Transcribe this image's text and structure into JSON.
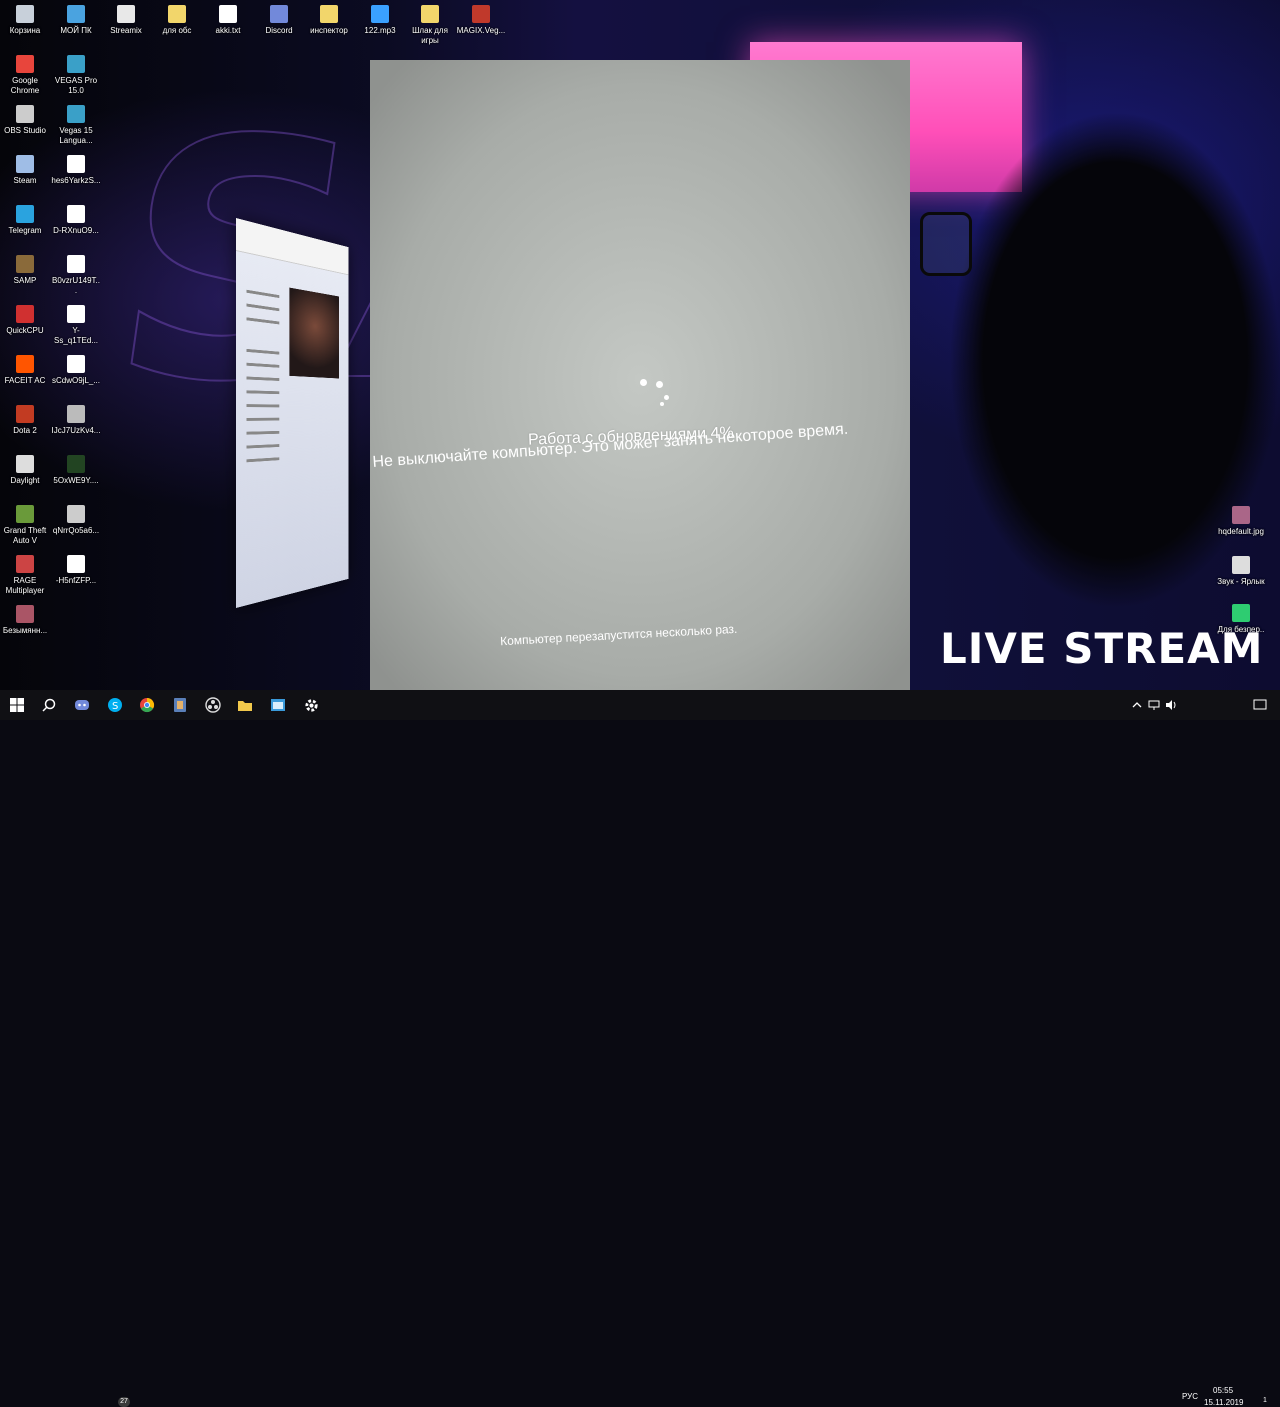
{
  "desktop_icons_left": [
    {
      "id": "recycle",
      "label": "Корзина",
      "icon": "recycle-bin-icon",
      "color": "#c8d0da"
    },
    {
      "id": "mypc",
      "label": "МОЙ ПК",
      "icon": "computer-icon",
      "color": "#4aa3e0"
    },
    {
      "id": "streamix",
      "label": "Streamix",
      "icon": "document-icon",
      "color": "#e8e8e8"
    },
    {
      "id": "obs-folder",
      "label": "для обс",
      "icon": "folder-icon",
      "color": "#f2d66b"
    },
    {
      "id": "akki",
      "label": "akki.txt",
      "icon": "text-file-icon",
      "color": "#ffffff"
    },
    {
      "id": "discord",
      "label": "Discord",
      "icon": "discord-icon",
      "color": "#7289da"
    },
    {
      "id": "inspector",
      "label": "инспектор",
      "icon": "folder-icon",
      "color": "#f2d66b"
    },
    {
      "id": "mp3",
      "label": "122.mp3",
      "icon": "audio-file-icon",
      "color": "#3aa0ff"
    },
    {
      "id": "shlak",
      "label": "Шлак для игры",
      "icon": "folder-icon",
      "color": "#f2d66b"
    },
    {
      "id": "magix",
      "label": "MAGIX.Veg...",
      "icon": "archive-icon",
      "color": "#c0392b"
    }
  ],
  "desktop_icons_col1": [
    {
      "id": "chrome",
      "label": "Google Chrome",
      "icon": "chrome-icon",
      "color": "#e8453c"
    },
    {
      "id": "obs",
      "label": "OBS Studio",
      "icon": "obs-icon",
      "color": "#cccccc"
    },
    {
      "id": "steam",
      "label": "Steam",
      "icon": "steam-icon",
      "color": "#9fbde6"
    },
    {
      "id": "telegram",
      "label": "Telegram",
      "icon": "telegram-icon",
      "color": "#2aa3df"
    },
    {
      "id": "samp",
      "label": "SAMP",
      "icon": "samp-icon",
      "color": "#8a6a3a"
    },
    {
      "id": "quickcpu",
      "label": "QuickCPU",
      "icon": "quickcpu-icon",
      "color": "#d03030"
    },
    {
      "id": "faceit",
      "label": "FACEIT AC",
      "icon": "faceit-icon",
      "color": "#ff5500"
    },
    {
      "id": "dota",
      "label": "Dota 2",
      "icon": "dota-icon",
      "color": "#c23b22"
    },
    {
      "id": "daylight",
      "label": "Daylight",
      "icon": "daylight-icon",
      "color": "#dddddd"
    },
    {
      "id": "gta",
      "label": "Grand Theft Auto V",
      "icon": "gta-icon",
      "color": "#6a9a3a"
    },
    {
      "id": "rage",
      "label": "RAGE Multiplayer",
      "icon": "rage-icon",
      "color": "#cc4444"
    },
    {
      "id": "unnamed",
      "label": "Безымянн...",
      "icon": "image-icon",
      "color": "#aa5566"
    }
  ],
  "desktop_icons_col2": [
    {
      "id": "vegas",
      "label": "VEGAS Pro 15.0",
      "icon": "vegas-icon",
      "color": "#3aa0c8"
    },
    {
      "id": "vegaslang",
      "label": "Vegas 15 Langua...",
      "icon": "vegas-icon",
      "color": "#3aa0c8"
    },
    {
      "id": "f1",
      "label": "hes6YarkzS...",
      "icon": "file-icon",
      "color": "#ffffff"
    },
    {
      "id": "f2",
      "label": "D-RXnuO9...",
      "icon": "file-icon",
      "color": "#ffffff"
    },
    {
      "id": "f3",
      "label": "B0vzrU149T...",
      "icon": "file-icon",
      "color": "#ffffff"
    },
    {
      "id": "f4",
      "label": "Y-Ss_q1TEd...",
      "icon": "file-icon",
      "color": "#ffffff"
    },
    {
      "id": "f5",
      "label": "sCdwO9jL_...",
      "icon": "file-icon",
      "color": "#ffffff"
    },
    {
      "id": "f6",
      "label": "IJcJ7UzKv4...",
      "icon": "image-icon",
      "color": "#bbbbbb"
    },
    {
      "id": "f7",
      "label": "5OxWE9Y....",
      "icon": "image-icon",
      "color": "#224422"
    },
    {
      "id": "f8",
      "label": "qNrrQo5a6...",
      "icon": "image-icon",
      "color": "#cccccc"
    },
    {
      "id": "f9",
      "label": "-H5nfZFP...",
      "icon": "file-icon",
      "color": "#ffffff"
    }
  ],
  "desktop_icons_right": [
    {
      "id": "hqdefault",
      "label": "hqdefault.jpg",
      "icon": "image-icon",
      "color": "#aa6688"
    },
    {
      "id": "sound",
      "label": "Звук - Ярлык",
      "icon": "speaker-icon",
      "color": "#dddddd"
    },
    {
      "id": "forplay",
      "label": "Для безпер..",
      "icon": "shortcut-icon",
      "color": "#2ecc71"
    }
  ],
  "update_screen": {
    "line1": "Работа с обновлениями  4%",
    "line2": "Не выключайте компьютер. Это может занять некоторое время.",
    "line3": "Компьютер перезапустится несколько раз."
  },
  "overlay": {
    "live_stream": "LIVE STREAM"
  },
  "taskbar": {
    "start_icon": "windows-icon",
    "skype_badge": "27",
    "language": "РУС",
    "time": "05:55",
    "date": "15.11.2019",
    "notification_count": "1"
  }
}
